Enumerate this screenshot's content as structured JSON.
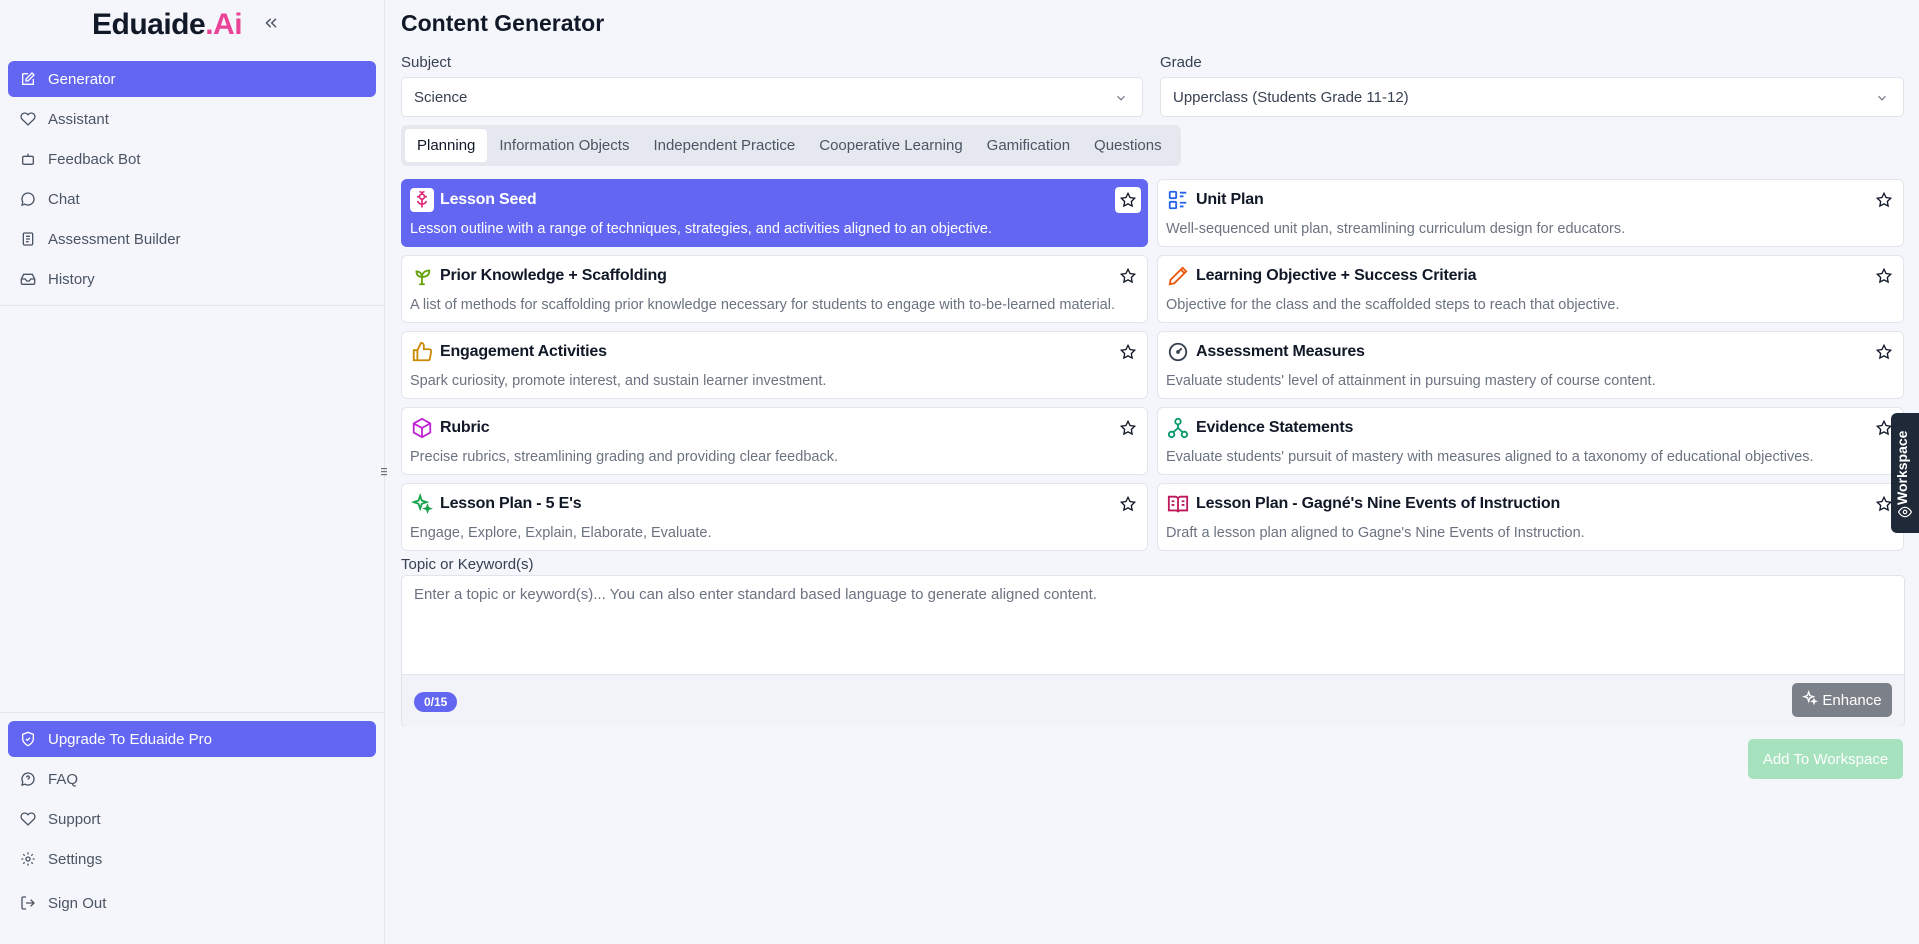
{
  "brand": {
    "name": "Eduaide",
    "suffix": ".Ai"
  },
  "sidebar": {
    "items": [
      {
        "label": "Generator",
        "icon": "edit-icon",
        "active": true
      },
      {
        "label": "Assistant",
        "icon": "heart-icon"
      },
      {
        "label": "Feedback Bot",
        "icon": "bot-icon"
      },
      {
        "label": "Chat",
        "icon": "chat-icon"
      },
      {
        "label": "Assessment Builder",
        "icon": "clipboard-icon"
      },
      {
        "label": "History",
        "icon": "inbox-icon"
      }
    ],
    "bottom": [
      {
        "label": "Upgrade To Eduaide Pro",
        "icon": "shield-icon",
        "active": true
      },
      {
        "label": "FAQ",
        "icon": "help-chat-icon"
      },
      {
        "label": "Support",
        "icon": "heart-icon"
      },
      {
        "label": "Settings",
        "icon": "gear-icon"
      },
      {
        "label": "Sign Out",
        "icon": "sign-out-icon"
      }
    ]
  },
  "main": {
    "title": "Content Generator",
    "subject": {
      "label": "Subject",
      "value": "Science"
    },
    "grade": {
      "label": "Grade",
      "value": "Upperclass (Students Grade 11-12)"
    },
    "tabs": [
      "Planning",
      "Information Objects",
      "Independent Practice",
      "Cooperative Learning",
      "Gamification",
      "Questions"
    ],
    "cards": [
      {
        "title": "Lesson Seed",
        "desc": "Lesson outline with a range of techniques, strategies, and activities aligned to an objective.",
        "icon": "flower-icon",
        "color": "#db2777",
        "active": true
      },
      {
        "title": "Unit Plan",
        "desc": "Well-sequenced unit plan, streamlining curriculum design for educators.",
        "icon": "grid-plan-icon",
        "color": "#2563eb"
      },
      {
        "title": "Prior Knowledge + Scaffolding",
        "desc": "A list of methods for scaffolding prior knowledge necessary for students to engage with to-be-learned material.",
        "icon": "sprout-icon",
        "color": "#65a30d"
      },
      {
        "title": "Learning Objective + Success Criteria",
        "desc": "Objective for the class and the scaffolded steps to reach that objective.",
        "icon": "pencil-icon",
        "color": "#ea580c"
      },
      {
        "title": "Engagement Activities",
        "desc": "Spark curiosity, promote interest, and sustain learner investment.",
        "icon": "thumbs-up-icon",
        "color": "#ca8a04"
      },
      {
        "title": "Assessment Measures",
        "desc": "Evaluate students' level of attainment in pursuing mastery of course content.",
        "icon": "gauge-icon",
        "color": "#374151"
      },
      {
        "title": "Rubric",
        "desc": "Precise rubrics, streamlining grading and providing clear feedback.",
        "icon": "cube-icon",
        "color": "#c026d3"
      },
      {
        "title": "Evidence Statements",
        "desc": "Evaluate students' pursuit of mastery with measures aligned to a taxonomy of educational objectives.",
        "icon": "network-icon",
        "color": "#059669"
      },
      {
        "title": "Lesson Plan - 5 E's",
        "desc": "Engage, Explore, Explain, Elaborate, Evaluate.",
        "icon": "sparkles-icon",
        "color": "#16a34a"
      },
      {
        "title": "Lesson Plan - Gagné's Nine Events of Instruction",
        "desc": "Draft a lesson plan aligned to Gagne's Nine Events of Instruction.",
        "icon": "book-open-icon",
        "color": "#be185d"
      }
    ],
    "topic": {
      "label": "Topic or Keyword(s)",
      "placeholder": "Enter a topic or keyword(s)... You can also enter standard based language to generate aligned content.",
      "counter": "0/15",
      "enhance": "Enhance"
    },
    "add_button": "Add To Workspace"
  },
  "workspace": {
    "label": "Workspace"
  }
}
